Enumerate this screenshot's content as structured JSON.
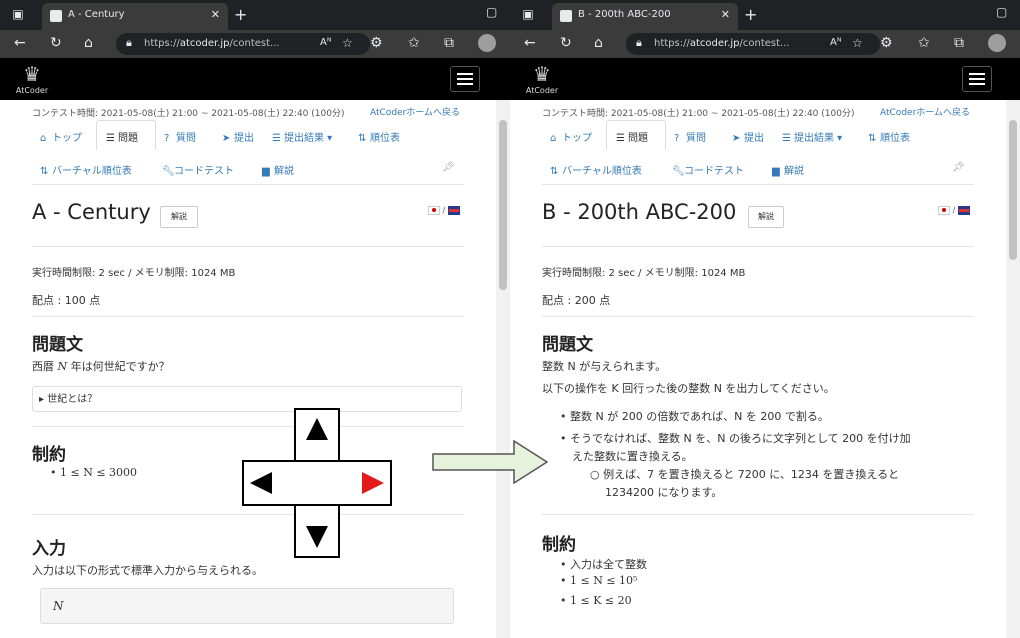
{
  "left": {
    "tab_title": "A - Century",
    "url_prefix": "https://",
    "url_host": "atcoder.jp",
    "url_path": "/contest...",
    "reader_label": "Aᴺ",
    "logo_text": "AtCoder",
    "contest_time": "コンテスト時間: 2021-05-08(土) 21:00 ~ 2021-05-08(土) 22:40 (100分)",
    "home_link": "AtCoderホームへ戻る",
    "menu": {
      "top": "トップ",
      "problems": "問題",
      "questions": "質問",
      "submit": "提出",
      "results": "提出結果 ▾",
      "standings": "順位表",
      "virtual": "バーチャル順位表",
      "codetest": "コードテスト",
      "editorial": "解説"
    },
    "title": "A - Century",
    "editorial_btn": "解説",
    "lang_sep": "/",
    "limits": "実行時間制限: 2 sec / メモリ制限: 1024 MB",
    "score": "配点 : 100 点",
    "section_statement": "問題文",
    "statement_pre": "西暦 ",
    "statement_var": "N",
    "statement_post": " 年は何世紀ですか？",
    "details": "▸ 世紀とは？",
    "section_constraints": "制約",
    "constraint_1": "1 ≤ N ≤ 3000",
    "section_input": "入力",
    "input_text": "入力は以下の形式で標準入力から与えられる。",
    "input_format": "N"
  },
  "right": {
    "tab_title": "B - 200th ABC-200",
    "url_prefix": "https://",
    "url_host": "atcoder.jp",
    "url_path": "/contest...",
    "reader_label": "Aᴺ",
    "logo_text": "AtCoder",
    "contest_time": "コンテスト時間: 2021-05-08(土) 21:00 ~ 2021-05-08(土) 22:40 (100分)",
    "home_link": "AtCoderホームへ戻る",
    "menu": {
      "top": "トップ",
      "problems": "問題",
      "questions": "質問",
      "submit": "提出",
      "results": "提出結果 ▾",
      "standings": "順位表",
      "virtual": "バーチャル順位表",
      "codetest": "コードテスト",
      "editorial": "解説"
    },
    "title": "B - 200th ABC-200",
    "editorial_btn": "解説",
    "lang_sep": "/",
    "limits": "実行時間制限: 2 sec / メモリ制限: 1024 MB",
    "score": "配点 : 200 点",
    "section_statement": "問題文",
    "statement_1": "整数 N が与えられます。",
    "statement_2": "以下の操作を K 回行った後の整数 N を出力してください。",
    "op_1": "整数 N が 200 の倍数であれば、N を 200 で割る。",
    "op_2a": "そうでなければ、整数 N を、N の後ろに文字列として 200 を付け加",
    "op_2b": "えた整数に置き換える。",
    "op_ex_a": "例えば、7 を置き換えると 7200 に、1234 を置き換えると",
    "op_ex_b": "1234200 になります。",
    "section_constraints": "制約",
    "constraint_1": "入力は全て整数",
    "constraint_2": "1 ≤ N ≤ 10⁵",
    "constraint_3": "1 ≤ K ≤ 20"
  },
  "colors": {
    "link": "#337ab7",
    "browser_dark": "#202124",
    "browser_toolbar": "#3b3b3b",
    "dpad_active": "#e31b1b",
    "arrow_fill": "#e6f2dc"
  },
  "dpad": {
    "active_direction": "right"
  }
}
